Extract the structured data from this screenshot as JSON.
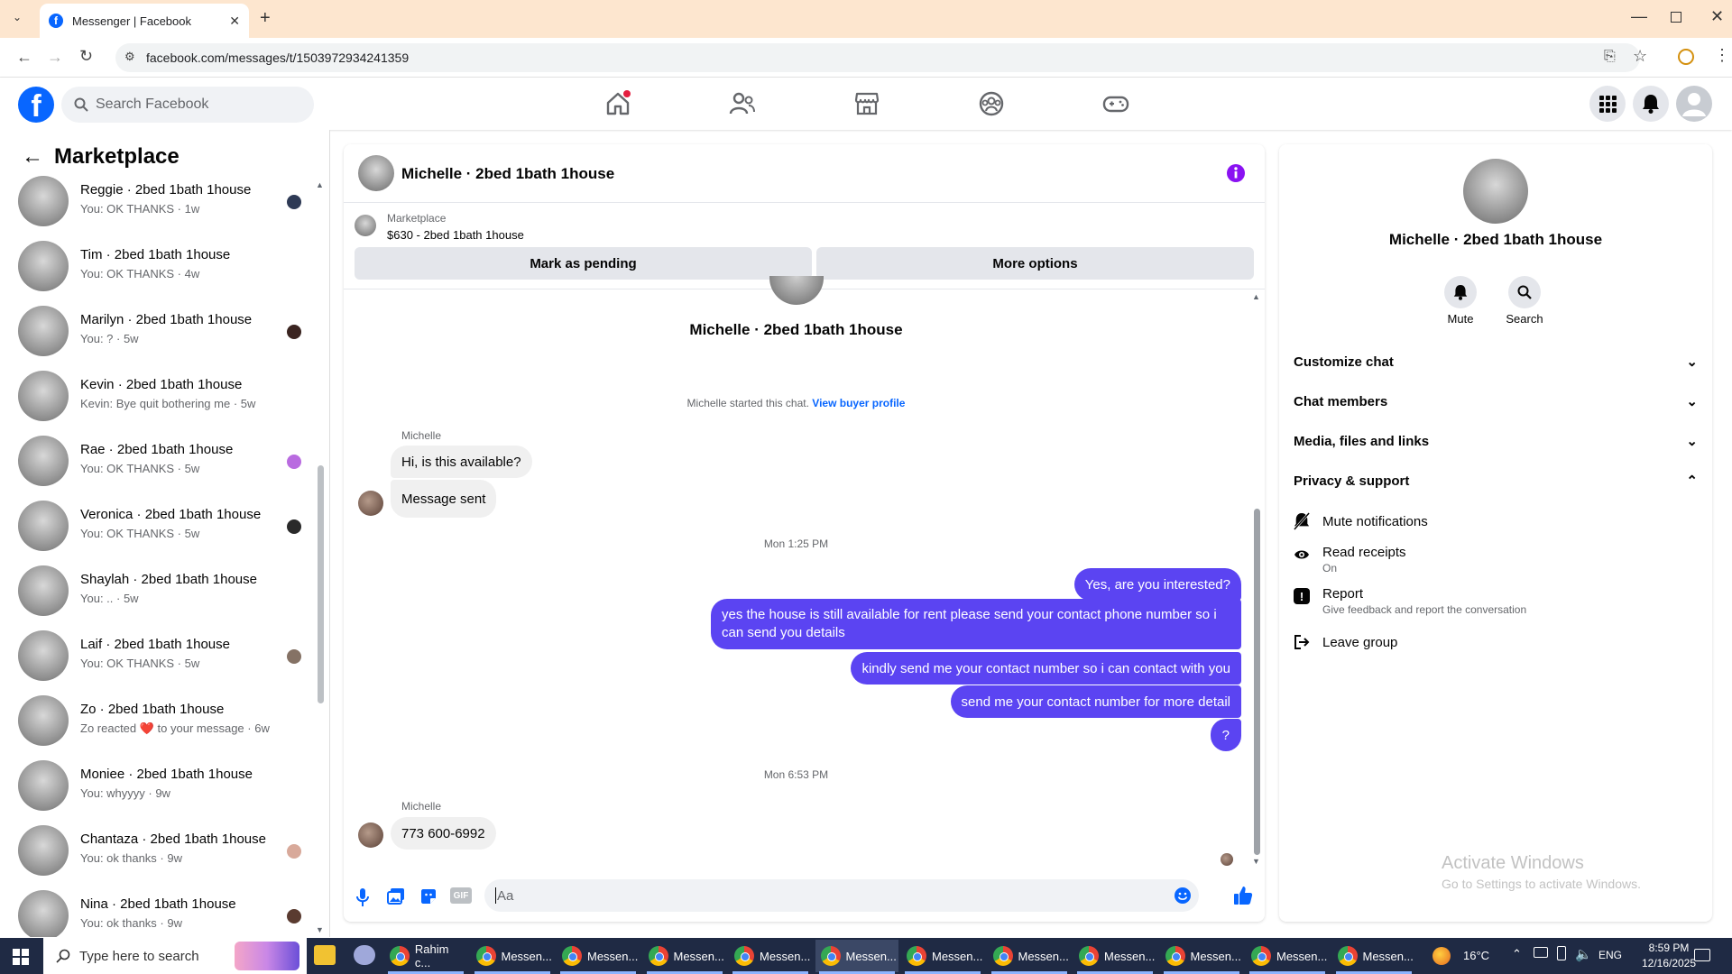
{
  "browser": {
    "tab_title": "Messenger | Facebook",
    "tab_close": "✕",
    "new_tab": "+",
    "url": "facebook.com/messages/t/1503972934241359"
  },
  "header": {
    "search_placeholder": "Search Facebook"
  },
  "left": {
    "title": "Marketplace",
    "conversations": [
      {
        "name": "Reggie · 2bed 1bath 1house",
        "preview": "You: OK THANKS · 1w"
      },
      {
        "name": "Tim · 2bed 1bath 1house",
        "preview": "You: OK THANKS · 4w"
      },
      {
        "name": "Marilyn · 2bed 1bath 1house",
        "preview": "You: ? · 5w"
      },
      {
        "name": "Kevin · 2bed 1bath 1house",
        "preview": "Kevin: Bye quit bothering me · 5w"
      },
      {
        "name": "Rae · 2bed 1bath 1house",
        "preview": "You: OK THANKS · 5w"
      },
      {
        "name": "Veronica · 2bed 1bath 1house",
        "preview": "You: OK THANKS · 5w"
      },
      {
        "name": "Shaylah · 2bed 1bath 1house",
        "preview": "You: .. · 5w"
      },
      {
        "name": "Laif · 2bed 1bath 1house",
        "preview": "You: OK THANKS · 5w"
      },
      {
        "name": "Zo · 2bed 1bath 1house",
        "preview": "Zo reacted ❤️ to your message · 6w"
      },
      {
        "name": "Moniee · 2bed 1bath 1house",
        "preview": "You: whyyyy · 9w"
      },
      {
        "name": "Chantaza · 2bed 1bath 1house",
        "preview": "You: ok thanks · 9w"
      },
      {
        "name": "Nina · 2bed 1bath 1house",
        "preview": "You: ok thanks · 9w"
      }
    ]
  },
  "chat": {
    "title": "Michelle · 2bed 1bath 1house",
    "listing_label": "Marketplace",
    "listing_detail": "$630 - 2bed 1bath 1house",
    "mark_pending": "Mark as pending",
    "more_options": "More options",
    "profile_name": "Michelle · 2bed 1bath 1house",
    "started": "Michelle started this chat.",
    "view_profile": "View buyer profile",
    "sender1": "Michelle",
    "msg1": "Hi, is this available?",
    "msg2": "Message sent",
    "ts1": "Mon 1:25 PM",
    "out1": "Yes, are you interested?",
    "out2a": "yes the house is still available for rent please send your contact phone number so i",
    "out2b": "can send you details",
    "out3": "kindly send me your contact number so i can contact with you",
    "out4": "send me your contact number for more detail",
    "out5": "?",
    "ts2": "Mon 6:53 PM",
    "sender2": "Michelle",
    "msg3": "773 600-6992",
    "composer_placeholder": "Aa"
  },
  "right": {
    "name": "Michelle · 2bed 1bath 1house",
    "mute": "Mute",
    "search": "Search",
    "sections": [
      "Customize chat",
      "Chat members",
      "Media, files and links",
      "Privacy & support"
    ],
    "mute_notifications": "Mute notifications",
    "read_receipts": "Read receipts",
    "read_receipts_status": "On",
    "report": "Report",
    "report_sub": "Give feedback and report the conversation",
    "leave_group": "Leave group",
    "watermark1": "Activate Windows",
    "watermark2": "Go to Settings to activate Windows."
  },
  "taskbar": {
    "search_placeholder": "Type here to search",
    "apps": [
      "Rahim c...",
      "Messen...",
      "Messen...",
      "Messen...",
      "Messen...",
      "Messen...",
      "Messen...",
      "Messen...",
      "Messen...",
      "Messen...",
      "Messen...",
      "Messen..."
    ],
    "temp": "16°C",
    "lang": "ENG",
    "time": "8:59 PM",
    "date": "12/16/2025"
  },
  "colors": {
    "fb_blue": "#0866ff",
    "outgoing_bubble": "#5b44f2",
    "tabbar": "#fde6cf",
    "taskbar": "#1f2a44"
  }
}
